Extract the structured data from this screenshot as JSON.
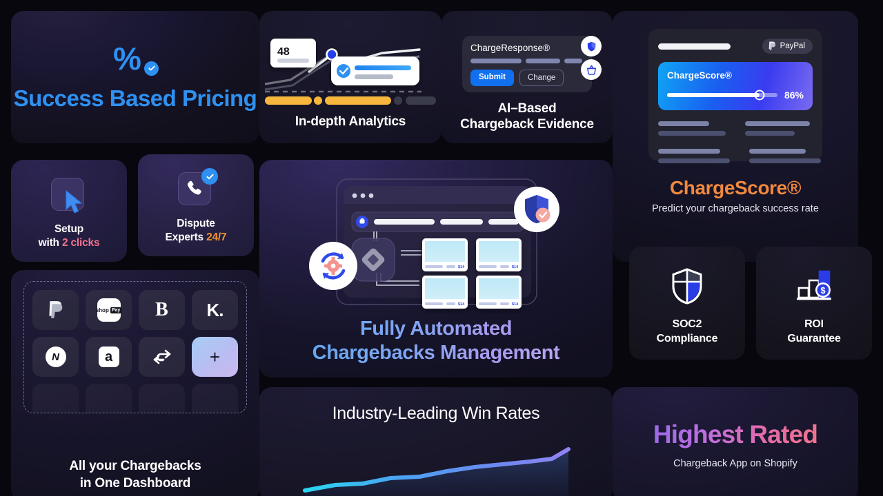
{
  "pricing": {
    "icon": "percent-check-icon",
    "title": "Success Based Pricing",
    "accent": "#2e91f2"
  },
  "analytics": {
    "title": "In-depth Analytics",
    "tooltip_value": "48",
    "point_color": "#2440e8",
    "progress_color": "#f6b73c"
  },
  "ai_evidence": {
    "panel_title": "ChargeResponse®",
    "submit_label": "Submit",
    "change_label": "Change",
    "fab_icons": [
      "shield-icon",
      "basket-icon"
    ],
    "title": "AI–Based\nChargeback Evidence",
    "title_line1": "AI–Based",
    "title_line2": "Chargeback Evidence"
  },
  "chargescore": {
    "provider_chip": "PayPal",
    "panel_title": "ChargeScore®",
    "score_percent": "86%",
    "score_value": 86,
    "title": "ChargeScore®",
    "subtitle": "Predict your chargeback success rate",
    "accent": "#f1883e"
  },
  "setup": {
    "icon": "cursor-click-icon",
    "line1": "Setup",
    "line2_pre": "with ",
    "line2_hl": "2 clicks"
  },
  "dispute": {
    "icon": "phone-check-icon",
    "line1": "Dispute",
    "line2_pre": "Experts ",
    "line2_hl": "24/7"
  },
  "integrations": {
    "tiles": [
      {
        "name": "paypal",
        "glyph": "P"
      },
      {
        "name": "shop-pay",
        "glyph": "shop"
      },
      {
        "name": "braintree",
        "glyph": "B"
      },
      {
        "name": "klarna",
        "glyph": "K."
      },
      {
        "name": "nuvei",
        "glyph": "N"
      },
      {
        "name": "adyen",
        "glyph": "a"
      },
      {
        "name": "link",
        "glyph": "chain"
      },
      {
        "name": "add-integration",
        "glyph": "+"
      }
    ],
    "title_line1": "All your Chargebacks",
    "title_line2": "in One Dashboard"
  },
  "hero": {
    "title_line1": "Fully Automated",
    "title_line2": "Chargebacks Management",
    "badges": [
      "sync-gear-icon",
      "shield-check-icon"
    ],
    "card_price_label": "$14"
  },
  "win_rates": {
    "title": "Industry-Leading Win Rates",
    "chart_data": {
      "type": "line",
      "title": "Industry-Leading Win Rates",
      "x": [
        0,
        1,
        2,
        3,
        4,
        5,
        6,
        7,
        8,
        9,
        10
      ],
      "values": [
        12,
        20,
        24,
        26,
        34,
        36,
        42,
        52,
        56,
        58,
        78
      ],
      "xlabel": "",
      "ylabel": "",
      "ylim": [
        0,
        100
      ],
      "grid": false,
      "legend": "none",
      "line_gradient": [
        "#2ad6f0",
        "#4aa3f2",
        "#7b7bef",
        "#8f84f2"
      ],
      "area_fill": true
    }
  },
  "soc2": {
    "icon": "shield-quadrant-icon",
    "line1": "SOC2",
    "line2": "Compliance"
  },
  "roi": {
    "icon": "bar-chart-dollar-icon",
    "line1": "ROI",
    "line2": "Guarantee"
  },
  "rated": {
    "title": "Highest Rated",
    "subtitle": "Chargeback App on Shopify"
  }
}
